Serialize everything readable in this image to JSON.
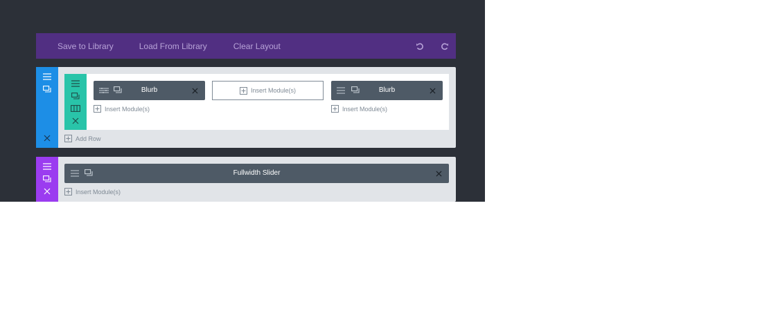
{
  "toolbar": {
    "save_label": "Save to Library",
    "load_label": "Load From Library",
    "clear_label": "Clear Layout",
    "undo_icon": "undo-icon",
    "redo_icon": "redo-icon"
  },
  "colors": {
    "page_background": "#2c3038",
    "toolbar": "#512f82",
    "standard_section": "#1d8ee6",
    "fullwidth_section": "#9b3cf0",
    "row": "#29c4a9",
    "module": "#4e5a66"
  },
  "section_standard": {
    "row": {
      "columns": [
        {
          "module": "Blurb",
          "insert_label": "Insert Module(s)"
        },
        {
          "insert_label": "Insert Module(s)"
        },
        {
          "module": "Blurb",
          "insert_label": "Insert Module(s)"
        }
      ]
    },
    "add_row_label": "Add Row"
  },
  "section_fullwidth": {
    "module": "Fullwidth Slider",
    "insert_label": "Insert Module(s)"
  }
}
